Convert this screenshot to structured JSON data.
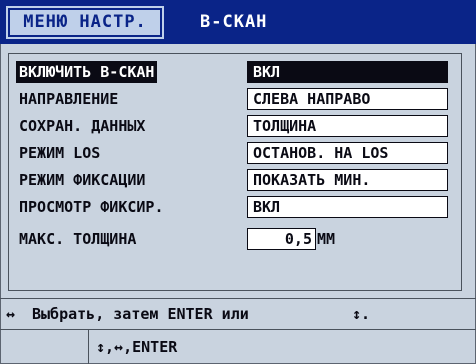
{
  "header": {
    "tab_label": "МЕНЮ НАСТР.",
    "title": "В-СКАН"
  },
  "settings": [
    {
      "label": "ВКЛЮЧИТЬ В-СКАН",
      "value": "ВКЛ",
      "selected": true
    },
    {
      "label": "НАПРАВЛЕНИЕ",
      "value": "СЛЕВА НАПРАВО"
    },
    {
      "label": "СОХРАН. ДАННЫХ",
      "value": "ТОЛЩИНА"
    },
    {
      "label": "РЕЖИМ LOS",
      "value": "ОСТАНОВ. НА LOS"
    },
    {
      "label": "РЕЖИМ ФИКСАЦИИ",
      "value": "ПОКАЗАТЬ МИН."
    },
    {
      "label": "ПРОСМОТР ФИКСИР.",
      "value": "ВКЛ"
    }
  ],
  "max_thickness": {
    "label": "МАКС. ТОЛЩИНА",
    "value": "0,5",
    "unit": "ММ"
  },
  "help": {
    "arrow_lr": "↔",
    "text": "Выбрать, затем ENTER или",
    "arrow_ud": "↕."
  },
  "keys": {
    "text": "↕,↔,ENTER"
  },
  "colors": {
    "header_bg": "#0a2488",
    "tab_bg": "#bfd0ea",
    "panel_bg": "#c9d3df",
    "selection_bg": "#0a0a14"
  }
}
